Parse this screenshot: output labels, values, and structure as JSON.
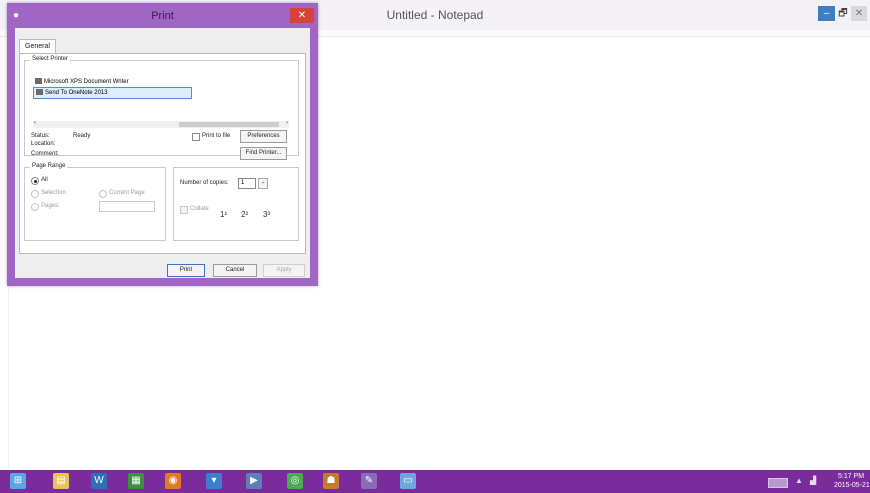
{
  "notepad": {
    "title": "Untitled - Notepad",
    "min_glyph": "–",
    "max_glyph": "🗗",
    "close_glyph": "✕"
  },
  "dialog": {
    "title": "Print",
    "close_glyph": "✕",
    "tab_general": "General",
    "select_printer": {
      "label": "Select Printer",
      "printers": [
        "Microsoft XPS Document Writer",
        "Send To OneNote 2013"
      ],
      "selected_index": 1
    },
    "scroll_left": "‹",
    "scroll_right": "›",
    "status_label": "Status:",
    "status_value": "Ready",
    "location_label": "Location:",
    "comment_label": "Comment:",
    "print_to_file": "Print to file",
    "preferences_btn": "Preferences",
    "find_printer_btn": "Find Printer...",
    "page_range": {
      "label": "Page Range",
      "all": "All",
      "selection": "Selection",
      "current_page": "Current Page",
      "pages": "Pages:"
    },
    "copies_label": "Number of copies:",
    "copies_value": "1",
    "collate_label": "Collate",
    "collate_icons": [
      "1¹",
      "2²",
      "3³"
    ],
    "spin_glyph": "÷",
    "print_btn": "Print",
    "cancel_btn": "Cancel",
    "apply_btn": "Apply"
  },
  "taskbar": {
    "icons": [
      {
        "name": "start-windows-icon",
        "glyph": "⊞",
        "color": "#5aa7e6"
      },
      {
        "name": "file-explorer-icon",
        "glyph": "▤",
        "color": "#e8c25a"
      },
      {
        "name": "word-icon",
        "glyph": "W",
        "color": "#2e6fb8"
      },
      {
        "name": "app-tiles-icon",
        "glyph": "▦",
        "color": "#3e8f3e"
      },
      {
        "name": "firefox-icon",
        "glyph": "◉",
        "color": "#e07a22"
      },
      {
        "name": "download-icon",
        "glyph": "▾",
        "color": "#3a7fd0"
      },
      {
        "name": "media-icon",
        "glyph": "▶",
        "color": "#5e7fb5"
      },
      {
        "name": "chrome-icon",
        "glyph": "◎",
        "color": "#4caa54"
      },
      {
        "name": "network-app-icon",
        "glyph": "☗",
        "color": "#c77a2a"
      },
      {
        "name": "paint-icon",
        "glyph": "✎",
        "color": "#8a6cb4"
      },
      {
        "name": "notepad-icon",
        "glyph": "▭",
        "color": "#6ea8da"
      }
    ],
    "clock_time": "5:17 PM",
    "clock_date": "2015-05-21"
  }
}
